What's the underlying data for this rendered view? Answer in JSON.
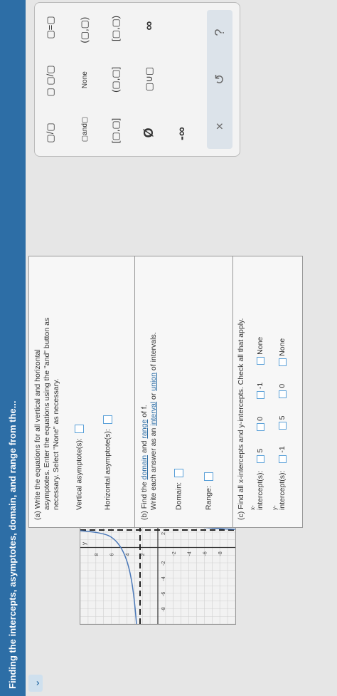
{
  "header": {
    "title": "Finding the intercepts, asymptotes, domain, and range from the..."
  },
  "graph": {
    "x_ticks": [
      "-8",
      "-6",
      "-4",
      "-2",
      "2",
      "4",
      "6",
      "8"
    ],
    "y_ticks": [
      "8",
      "6",
      "4",
      "2",
      "-2",
      "-4",
      "-6",
      "-8"
    ],
    "x_label": "x",
    "y_label": "y"
  },
  "part_a": {
    "line1": "(a) Write the equations for all vertical and horizontal",
    "line2": "asymptotes. Enter the equations using the \"and\" button as",
    "line3": "necessary. Select \"None\" as necessary.",
    "vertical_label": "Vertical asymptote(s):",
    "horizontal_label": "Horizontal asymptote(s):"
  },
  "part_b": {
    "line1_prefix": "(b) Find the ",
    "domain_link": "domain",
    "and_word": " and ",
    "range_link": "range",
    "line1_suffix": " of f.",
    "line2_prefix": "Write each answer as an ",
    "interval_link": "interval",
    "or_word": " or ",
    "union_link": "union",
    "line2_suffix": " of intervals.",
    "domain_label": "Domain:",
    "range_label": "Range:"
  },
  "part_c": {
    "prompt": "(c) Find all x-intercepts and y-intercepts. Check all that apply.",
    "x_label_top": "x-",
    "x_label_bottom": "intercept(s):",
    "x_options": [
      "5",
      "0",
      "-1",
      "None"
    ],
    "y_label_top": "y-",
    "y_label_bottom": "intercept(s):",
    "y_options": [
      "-1",
      "5",
      "0",
      "None"
    ]
  },
  "palette": {
    "row1": [
      "▢/▢",
      "▢ ▢/▢",
      "▢=▢"
    ],
    "row2": [
      "▢and▢",
      "None",
      "(▢,▢)"
    ],
    "row3": [
      "[▢,▢]",
      "(▢,▢]",
      "[▢,▢)"
    ],
    "row4": [
      "Ø",
      "▢∪▢",
      "∞"
    ],
    "row5": [
      "-∞"
    ],
    "footer": [
      "×",
      "↺",
      "?"
    ]
  }
}
